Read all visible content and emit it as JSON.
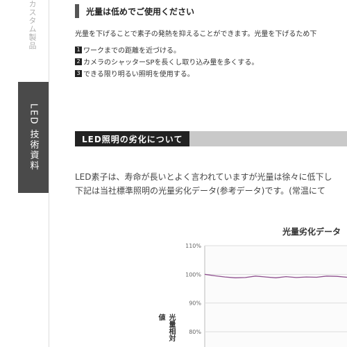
{
  "side": {
    "vertical_text": "カスタム製品",
    "tab_label": "LED 技術資料"
  },
  "section1": {
    "heading": "光量は低めでご使用ください",
    "intro": "光量を下げることで素子の発熱を抑えることができます。光量を下げるため下",
    "items": [
      {
        "num": "1",
        "text": "ワークまでの距離を近づける。"
      },
      {
        "num": "2",
        "text": "カメラのシャッターSPを長くし取り込み量を多くする。"
      },
      {
        "num": "3",
        "text": "できる限り明るい照明を使用する。"
      }
    ]
  },
  "section2": {
    "heading": "LED照明の劣化について",
    "line1": "LED素子は、寿命が長いとよく言われていますが光量は徐々に低下し",
    "line2": "下記は当社標準照明の光量劣化データ(参考データ)です。(常温にて"
  },
  "chart_data": {
    "type": "line",
    "title": "光量劣化データ",
    "ylabel": "光量相対値",
    "xlabel": "",
    "ylim": [
      75,
      110
    ],
    "yticks": [
      "110%",
      "100%",
      "90%",
      "80%"
    ],
    "series": [
      {
        "color": "#8e4f8e",
        "values": [
          100,
          99.5,
          99.1,
          98.8,
          98.9,
          99.4,
          99.1,
          98.8,
          99.2,
          98.9,
          99.1,
          99.0,
          99.4,
          99.3,
          99.0
        ]
      }
    ]
  }
}
